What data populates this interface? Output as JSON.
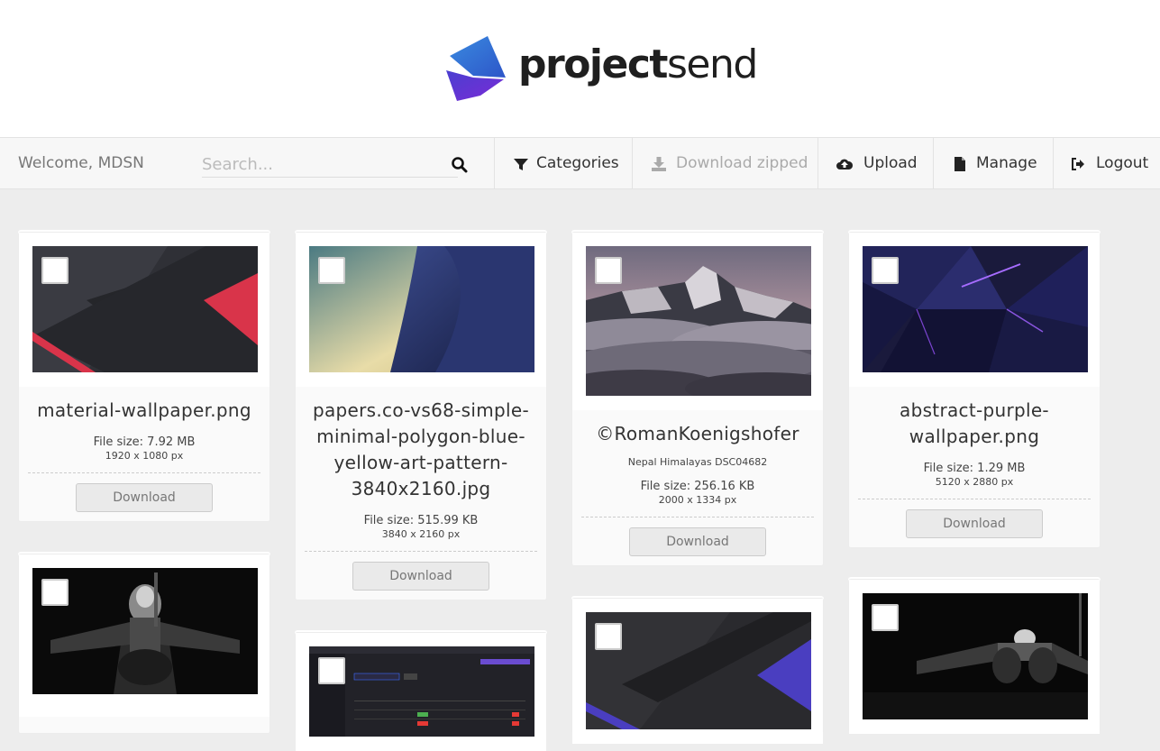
{
  "brand": {
    "name_bold": "project",
    "name_light": "send"
  },
  "nav": {
    "welcome": "Welcome, MDSN",
    "search_placeholder": "Search...",
    "items": [
      {
        "label": "Categories",
        "icon": "filter-icon"
      },
      {
        "label": "Download zipped",
        "icon": "download-icon"
      },
      {
        "label": "Upload",
        "icon": "cloud-upload-icon"
      },
      {
        "label": "Manage",
        "icon": "file-icon"
      },
      {
        "label": "Logout",
        "icon": "sign-out-icon"
      }
    ]
  },
  "files": [
    {
      "title": "material-wallpaper.png",
      "size": "File size: 7.92 MB",
      "dims": "1920 x 1080 px",
      "button": "Download"
    },
    {
      "title": "papers.co-vs68-simple-minimal-polygon-blue-yellow-art-pattern-3840x2160.jpg",
      "size": "File size: 515.99 KB",
      "dims": "3840 x 2160 px",
      "button": "Download"
    },
    {
      "title": "©RomanKoenigshofer",
      "description": "Nepal Himalayas DSC04682",
      "size": "File size: 256.16 KB",
      "dims": "2000 x 1334 px",
      "button": "Download"
    },
    {
      "title": "abstract-purple-wallpaper.png",
      "size": "File size: 1.29 MB",
      "dims": "5120 x 2880 px",
      "button": "Download"
    }
  ]
}
